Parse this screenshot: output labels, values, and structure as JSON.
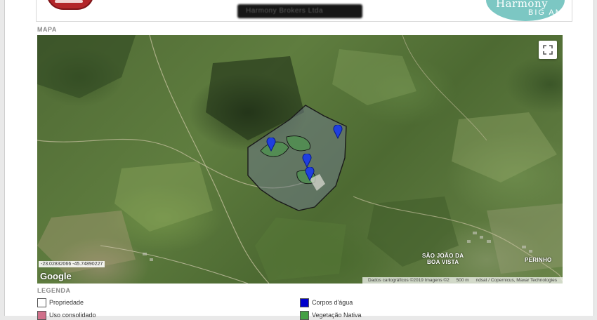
{
  "header": {
    "redacted_text": "Harmony Brokers Ltda",
    "brand_name": "Harmony",
    "brand_sub": "BIG AM",
    "brand_color": "#7cc7c3",
    "left_logo_color": "#b3262a"
  },
  "map": {
    "section_label": "MAPA",
    "coordinates": "-23.02832066  -45.74890227",
    "google_label": "Google",
    "attribution": {
      "data": "Dados cartográficos ©2019 Imagens ©2",
      "scale": "500 m",
      "credits": "ndsat / Copernicus, Maxar Technologies"
    },
    "places": [
      {
        "name": "SÃO JOÃO DA\nBOA VISTA"
      },
      {
        "name": "PERINHO"
      }
    ],
    "markers": [
      {
        "label": "marker-1"
      },
      {
        "label": "marker-2"
      },
      {
        "label": "marker-3"
      },
      {
        "label": "marker-4"
      }
    ],
    "marker_color": "#1f3fe0",
    "property_outline_color": "#1a1a1a"
  },
  "legend": {
    "section_label": "LEGENDA",
    "items": [
      {
        "label": "Propriedade",
        "color": "#ffffff"
      },
      {
        "label": "Corpos d'água",
        "color": "#0000cc"
      },
      {
        "label": "Uso consolidado",
        "color": "#d0708a"
      },
      {
        "label": "Vegetação Nativa",
        "color": "#44a044"
      }
    ]
  }
}
